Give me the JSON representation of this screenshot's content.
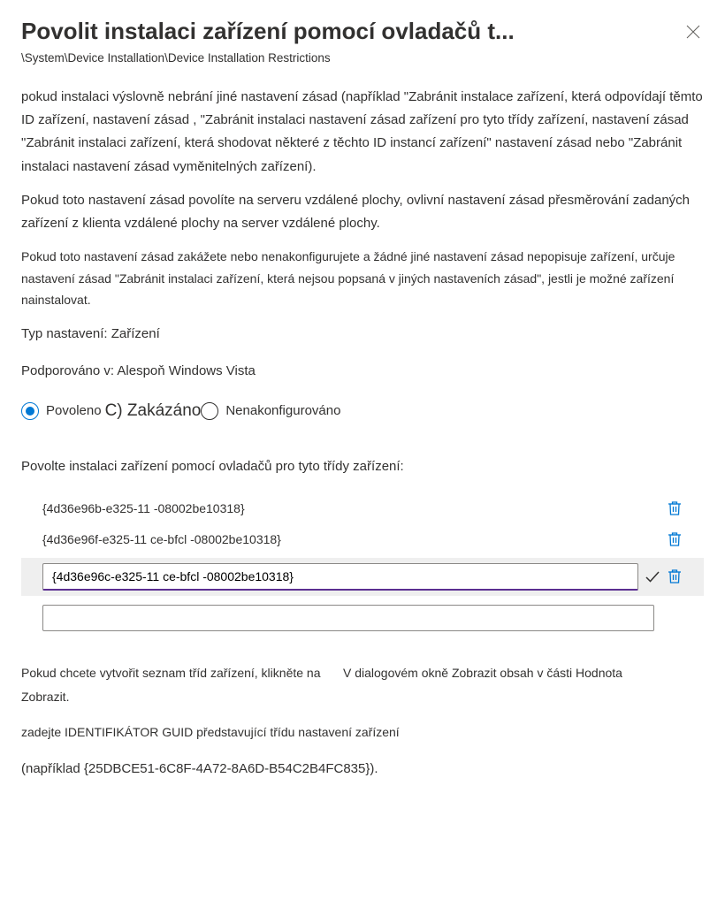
{
  "header": {
    "title": "Povolit instalaci zařízení pomocí ovladačů t..."
  },
  "breadcrumb": "\\System\\Device Installation\\Device Installation Restrictions",
  "description": {
    "p1": "pokud instalaci výslovně nebrání jiné nastavení zásad (například \"Zabránit instalace zařízení, která odpovídají těmto ID zařízení, nastavení zásad , \"Zabránit instalaci nastavení zásad zařízení pro tyto třídy zařízení, nastavení zásad \"Zabránit instalaci zařízení, která shodovat některé z těchto ID instancí zařízení\" nastavení zásad nebo \"Zabránit instalaci nastavení zásad vyměnitelných zařízení).",
    "p2": "Pokud toto nastavení zásad povolíte na serveru vzdálené plochy, ovlivní nastavení zásad přesměrování zadaných zařízení z klienta vzdálené plochy na server vzdálené plochy.",
    "p3": "Pokud toto nastavení zásad zakážete nebo nenakonfigurujete a žádné jiné nastavení zásad nepopisuje zařízení, určuje nastavení zásad \"Zabránit instalaci zařízení, která nejsou popsaná v jiných nastaveních zásad\", jestli je možné zařízení nainstalovat."
  },
  "settingType": "Typ nastavení: Zařízení",
  "supported": "Podporováno v: Alespoň Windows Vista",
  "radios": {
    "enabled": "Povoleno",
    "disabled": "C) Zakázáno",
    "notconfigured": "Nenakonfigurováno"
  },
  "listLabel": "Povolte instalaci zařízení pomocí ovladačů pro tyto třídy zařízení:",
  "listItems": [
    "{4d36e96b-e325-11 -08002be10318}",
    "{4d36e96f-e325-11 ce-bfcl -08002be10318}"
  ],
  "editingValue": "{4d36e96c-e325-11 ce-bfcl -08002be10318}",
  "bottom": {
    "row1left": "Pokud chcete vytvořit seznam tříd zařízení, klikněte na Zobrazit.",
    "row1right": "V dialogovém okně Zobrazit obsah v části Hodnota",
    "p2": "zadejte IDENTIFIKÁTOR GUID představující třídu nastavení zařízení",
    "p3": "(například {25DBCE51-6C8F-4A72-8A6D-B54C2B4FC835})."
  }
}
